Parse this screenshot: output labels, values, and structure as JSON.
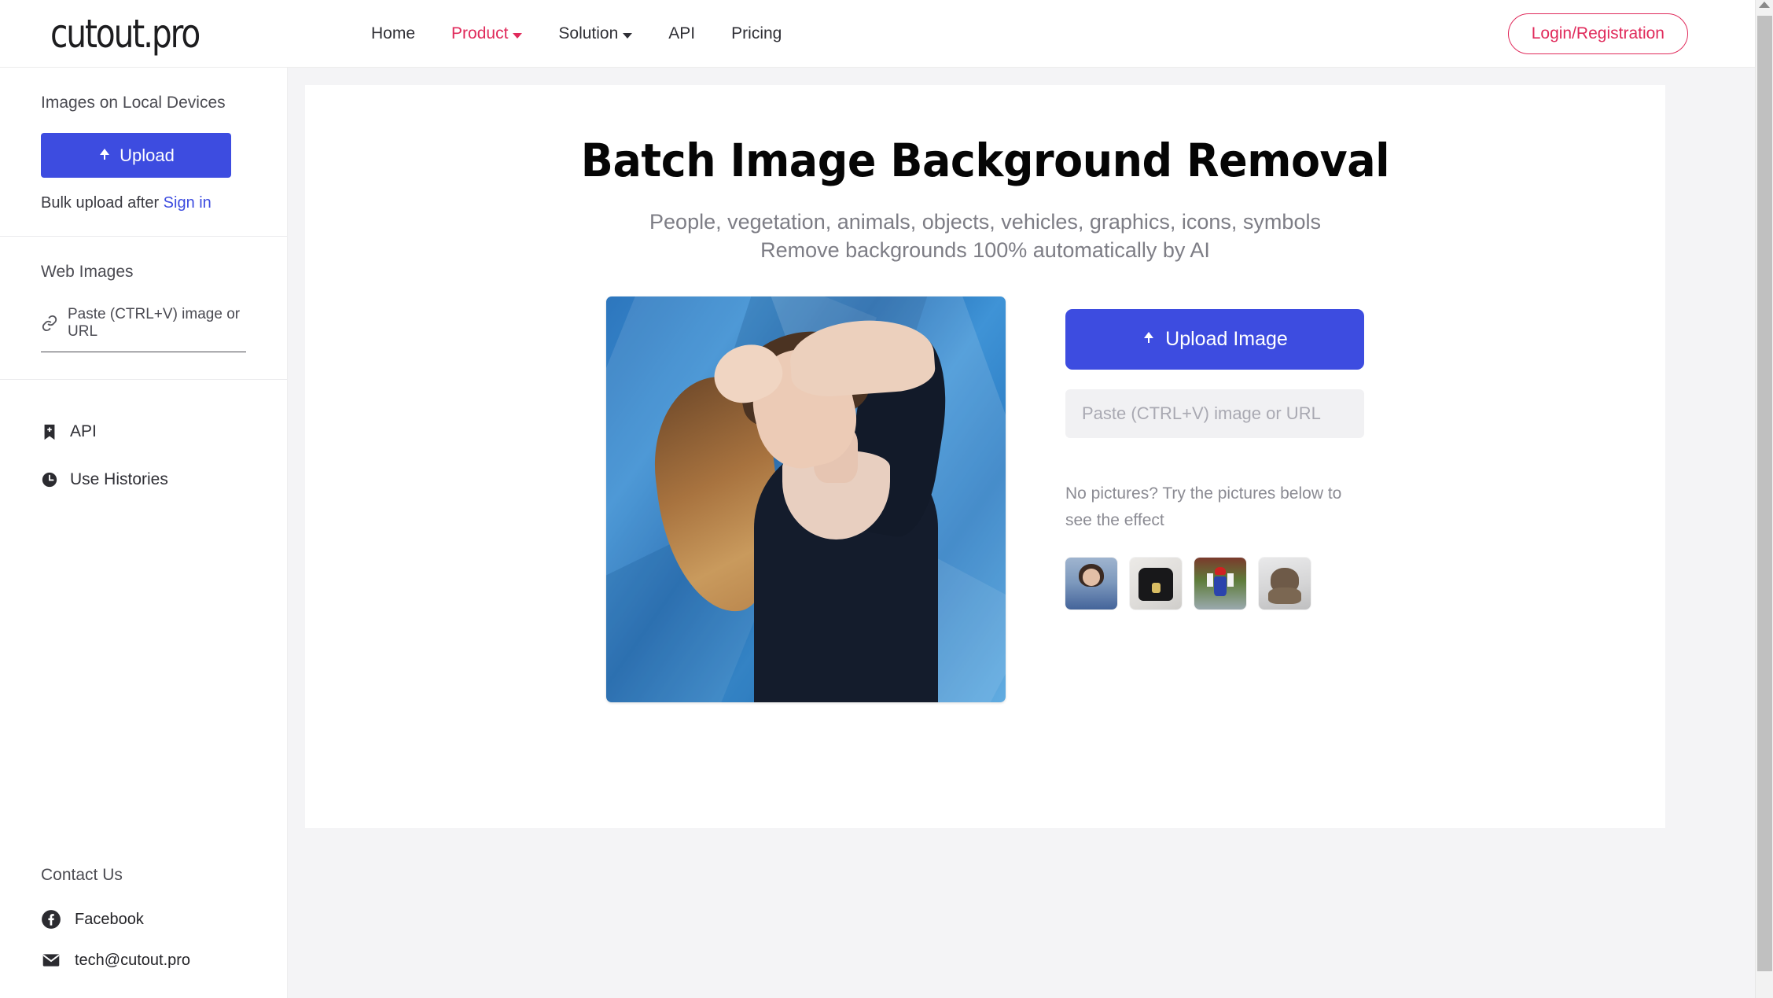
{
  "brand": {
    "logo": "cutout.pro"
  },
  "nav": {
    "items": [
      {
        "label": "Home",
        "accent": false,
        "caret": false
      },
      {
        "label": "Product",
        "accent": true,
        "caret": true
      },
      {
        "label": "Solution",
        "accent": false,
        "caret": true
      },
      {
        "label": "API",
        "accent": false,
        "caret": false
      },
      {
        "label": "Pricing",
        "accent": false,
        "caret": false
      }
    ],
    "login_label": "Login/Registration"
  },
  "sidebar": {
    "local_title": "Images on Local Devices",
    "upload_label": "Upload",
    "bulk_prefix": "Bulk upload after ",
    "bulk_link": "Sign in",
    "web_title": "Web Images",
    "paste_placeholder": "Paste (CTRL+V) image or URL",
    "items": [
      {
        "label": "API",
        "icon": "bookmark-plus-icon"
      },
      {
        "label": "Use Histories",
        "icon": "clock-icon"
      }
    ],
    "contact_title": "Contact Us",
    "contacts": [
      {
        "label": "Facebook",
        "icon": "facebook-icon"
      },
      {
        "label": "tech@cutout.pro",
        "icon": "mail-icon"
      }
    ]
  },
  "main": {
    "title": "Batch Image Background Removal",
    "subtitle_line1": "People, vegetation, animals, objects, vehicles, graphics, icons, symbols",
    "subtitle_line2": "Remove backgrounds 100% automatically by AI",
    "upload_image_label": "Upload Image",
    "paste_placeholder": "Paste (CTRL+V) image or URL",
    "no_pictures_text": "No pictures? Try the pictures below to see the effect",
    "samples": [
      {
        "name": "child-portrait"
      },
      {
        "name": "black-tshirt"
      },
      {
        "name": "mario-figure"
      },
      {
        "name": "puppy"
      }
    ],
    "hero_image_alt": "Woman in black top against blue geometric background"
  },
  "colors": {
    "accent_pink": "#e02a5b",
    "primary_blue": "#3d4ce0",
    "page_bg": "#f4f4f6",
    "muted_text": "#8b8b93"
  }
}
